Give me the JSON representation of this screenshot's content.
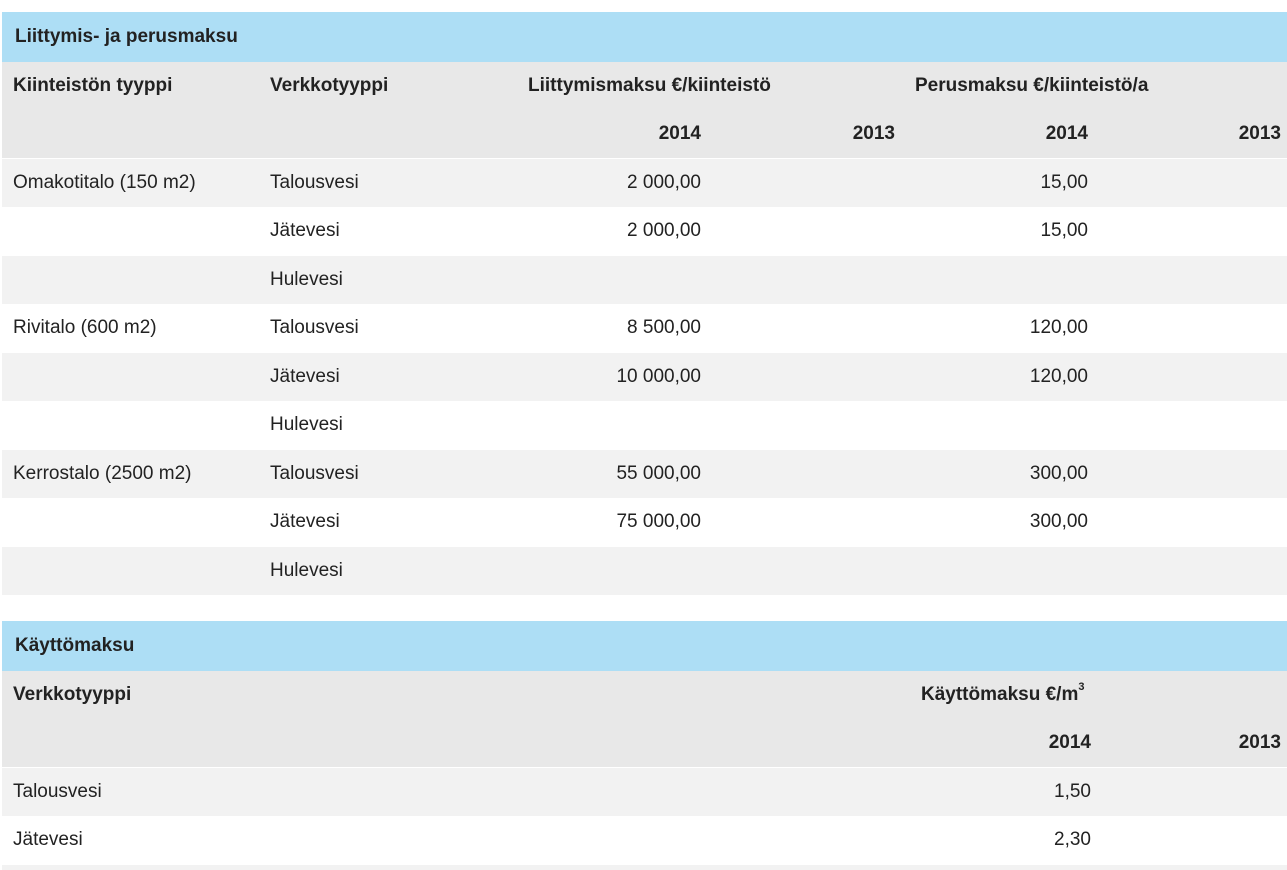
{
  "table1": {
    "title": "Liittymis- ja perusmaksu",
    "head": {
      "col_type": "Kiinteistön tyyppi",
      "col_network": "Verkkotyyppi",
      "col_connection": "Liittymismaksu €/kiinteistö",
      "col_basic": "Perusmaksu €/kiinteistö/a",
      "year_a": "2014",
      "year_b": "2013",
      "year_c": "2014",
      "year_d": "2013"
    },
    "rows": [
      {
        "type": "Omakotitalo (150 m2)",
        "network": "Talousvesi",
        "conn_2014": "2 000,00",
        "basic_2014": "15,00"
      },
      {
        "type": "",
        "network": "Jätevesi",
        "conn_2014": "2 000,00",
        "basic_2014": "15,00"
      },
      {
        "type": "",
        "network": "Hulevesi",
        "conn_2014": "",
        "basic_2014": ""
      },
      {
        "type": "Rivitalo (600 m2)",
        "network": "Talousvesi",
        "conn_2014": "8 500,00",
        "basic_2014": "120,00"
      },
      {
        "type": "",
        "network": "Jätevesi",
        "conn_2014": "10 000,00",
        "basic_2014": "120,00"
      },
      {
        "type": "",
        "network": "Hulevesi",
        "conn_2014": "",
        "basic_2014": ""
      },
      {
        "type": "Kerrostalo (2500 m2)",
        "network": "Talousvesi",
        "conn_2014": "55 000,00",
        "basic_2014": "300,00"
      },
      {
        "type": "",
        "network": "Jätevesi",
        "conn_2014": "75 000,00",
        "basic_2014": "300,00"
      },
      {
        "type": "",
        "network": "Hulevesi",
        "conn_2014": "",
        "basic_2014": ""
      }
    ]
  },
  "table2": {
    "title": "Käyttömaksu",
    "head": {
      "col_network": "Verkkotyyppi",
      "col_usage": "Käyttömaksu €/m",
      "col_usage_sup": "3",
      "year_a": "2014",
      "year_b": "2013"
    },
    "rows": [
      {
        "network": "Talousvesi",
        "usage_2014": "1,50"
      },
      {
        "network": "Jätevesi",
        "usage_2014": "2,30"
      }
    ]
  },
  "colors": {
    "section_header": "#addef5",
    "header_row": "#e8e8e8",
    "stripe": "#f2f2f2"
  }
}
